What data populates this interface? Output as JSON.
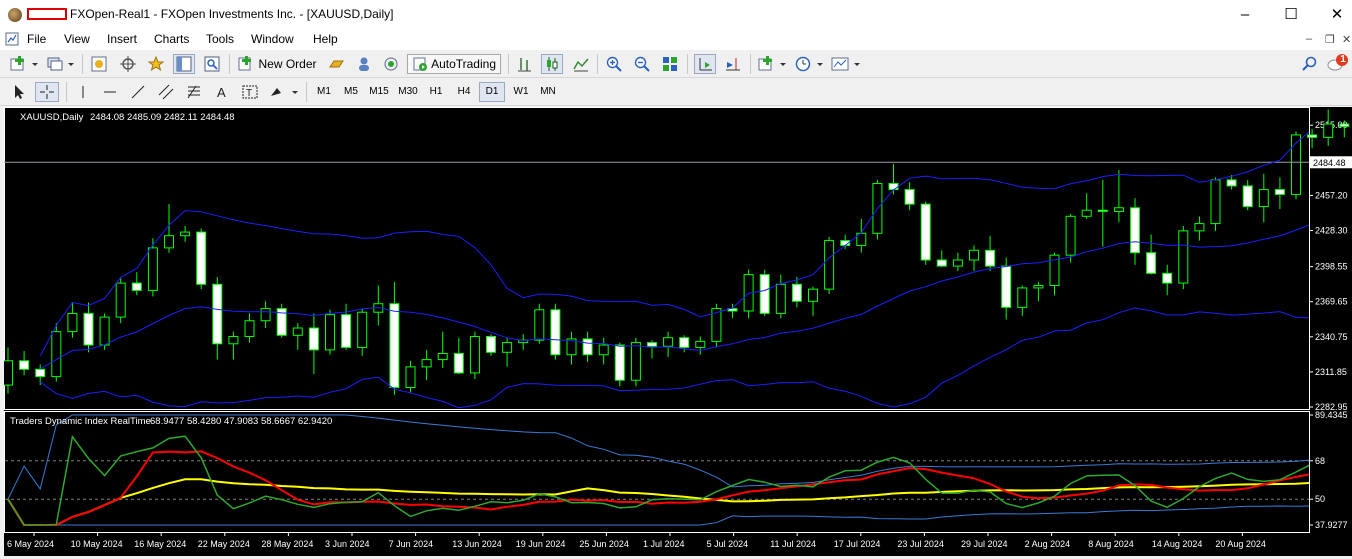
{
  "window": {
    "title": "FXOpen-Real1 - FXOpen Investments Inc. - [XAUUSD,Daily]",
    "minimize_icon": "minimize-icon",
    "maximize_icon": "maximize-icon",
    "close_icon": "close-icon"
  },
  "menu": {
    "items": [
      "File",
      "View",
      "Insert",
      "Charts",
      "Tools",
      "Window",
      "Help"
    ]
  },
  "toolbar": {
    "new_order_label": "New Order",
    "autotrading_label": "AutoTrading",
    "notifications_count": "1"
  },
  "timeframes": {
    "items": [
      "M1",
      "M5",
      "M15",
      "M30",
      "H1",
      "H4",
      "D1",
      "W1",
      "MN"
    ],
    "active": "D1"
  },
  "colors": {
    "candle_up": "#000000",
    "candle_border": "#00ff00",
    "candle_down": "#ffffff",
    "bands": "#1e1eff",
    "rsi_line": "#2ea82e",
    "signal_line": "#ff0000",
    "market_base": "#ffff00",
    "volatility_band": "#3a7bd5"
  },
  "chart_data": [
    {
      "type": "candlestick",
      "title": "XAUUSD,Daily",
      "ohlc_header": "2484.08 2485.09 2482.11 2484.48",
      "current_price_label": "2484.48",
      "current_price": 2484.48,
      "y_tick_labels": [
        "2515.00",
        "2484.48",
        "2457.20",
        "2428.30",
        "2398.55",
        "2369.65",
        "2340.75",
        "2311.85",
        "2282.95"
      ],
      "ylim": [
        2282.95,
        2530
      ],
      "x_tick_labels": [
        "6 May 2024",
        "10 May 2024",
        "16 May 2024",
        "22 May 2024",
        "28 May 2024",
        "3 Jun 2024",
        "7 Jun 2024",
        "13 Jun 2024",
        "19 Jun 2024",
        "25 Jun 2024",
        "1 Jul 2024",
        "5 Jul 2024",
        "11 Jul 2024",
        "17 Jul 2024",
        "23 Jul 2024",
        "29 Jul 2024",
        "2 Aug 2024",
        "8 Aug 2024",
        "14 Aug 2024",
        "20 Aug 2024"
      ],
      "candles": [
        [
          2301,
          2332,
          2294,
          2321
        ],
        [
          2321,
          2329,
          2309,
          2314
        ],
        [
          2314,
          2318,
          2301,
          2308
        ],
        [
          2308,
          2352,
          2304,
          2345
        ],
        [
          2345,
          2369,
          2340,
          2360
        ],
        [
          2360,
          2369,
          2328,
          2334
        ],
        [
          2334,
          2360,
          2330,
          2357
        ],
        [
          2357,
          2390,
          2352,
          2385
        ],
        [
          2385,
          2394,
          2375,
          2379
        ],
        [
          2379,
          2422,
          2374,
          2414
        ],
        [
          2414,
          2450,
          2410,
          2424
        ],
        [
          2424,
          2432,
          2419,
          2427
        ],
        [
          2427,
          2430,
          2380,
          2384
        ],
        [
          2384,
          2390,
          2322,
          2335
        ],
        [
          2335,
          2345,
          2322,
          2341
        ],
        [
          2341,
          2360,
          2336,
          2354
        ],
        [
          2354,
          2370,
          2348,
          2364
        ],
        [
          2364,
          2368,
          2340,
          2342
        ],
        [
          2342,
          2352,
          2330,
          2348
        ],
        [
          2348,
          2360,
          2310,
          2330
        ],
        [
          2330,
          2363,
          2326,
          2359
        ],
        [
          2359,
          2368,
          2330,
          2332
        ],
        [
          2332,
          2364,
          2325,
          2361
        ],
        [
          2361,
          2383,
          2350,
          2368
        ],
        [
          2368,
          2386,
          2293,
          2299
        ],
        [
          2299,
          2321,
          2295,
          2316
        ],
        [
          2316,
          2330,
          2305,
          2322
        ],
        [
          2322,
          2345,
          2315,
          2327
        ],
        [
          2327,
          2340,
          2310,
          2311
        ],
        [
          2311,
          2345,
          2306,
          2341
        ],
        [
          2341,
          2343,
          2325,
          2328
        ],
        [
          2328,
          2340,
          2316,
          2336
        ],
        [
          2336,
          2343,
          2330,
          2338
        ],
        [
          2338,
          2368,
          2335,
          2363
        ],
        [
          2363,
          2368,
          2322,
          2326
        ],
        [
          2326,
          2345,
          2318,
          2339
        ],
        [
          2339,
          2345,
          2320,
          2326
        ],
        [
          2326,
          2340,
          2318,
          2334
        ],
        [
          2334,
          2336,
          2300,
          2305
        ],
        [
          2305,
          2340,
          2300,
          2336
        ],
        [
          2336,
          2338,
          2323,
          2333
        ],
        [
          2333,
          2345,
          2324,
          2340
        ],
        [
          2340,
          2342,
          2328,
          2332
        ],
        [
          2332,
          2341,
          2326,
          2337
        ],
        [
          2337,
          2368,
          2332,
          2364
        ],
        [
          2364,
          2368,
          2356,
          2362
        ],
        [
          2362,
          2396,
          2356,
          2392
        ],
        [
          2392,
          2396,
          2358,
          2360
        ],
        [
          2360,
          2392,
          2356,
          2384
        ],
        [
          2384,
          2390,
          2365,
          2370
        ],
        [
          2370,
          2382,
          2358,
          2380
        ],
        [
          2380,
          2423,
          2376,
          2420
        ],
        [
          2420,
          2425,
          2413,
          2416
        ],
        [
          2416,
          2438,
          2410,
          2426
        ],
        [
          2426,
          2470,
          2421,
          2467
        ],
        [
          2467,
          2483,
          2458,
          2462
        ],
        [
          2462,
          2468,
          2445,
          2450
        ],
        [
          2450,
          2452,
          2400,
          2404
        ],
        [
          2404,
          2412,
          2398,
          2399
        ],
        [
          2399,
          2410,
          2395,
          2404
        ],
        [
          2404,
          2416,
          2395,
          2412
        ],
        [
          2412,
          2424,
          2395,
          2399
        ],
        [
          2399,
          2406,
          2355,
          2365
        ],
        [
          2365,
          2383,
          2358,
          2381
        ],
        [
          2381,
          2386,
          2370,
          2383
        ],
        [
          2383,
          2410,
          2375,
          2408
        ],
        [
          2408,
          2442,
          2402,
          2440
        ],
        [
          2440,
          2459,
          2438,
          2445
        ],
        [
          2445,
          2470,
          2415,
          2444
        ],
        [
          2444,
          2478,
          2435,
          2447
        ],
        [
          2447,
          2455,
          2400,
          2410
        ],
        [
          2410,
          2425,
          2392,
          2393
        ],
        [
          2393,
          2400,
          2375,
          2385
        ],
        [
          2385,
          2432,
          2380,
          2428
        ],
        [
          2428,
          2440,
          2420,
          2434
        ],
        [
          2434,
          2472,
          2428,
          2470
        ],
        [
          2470,
          2474,
          2462,
          2465
        ],
        [
          2465,
          2470,
          2445,
          2448
        ],
        [
          2448,
          2475,
          2435,
          2462
        ],
        [
          2462,
          2472,
          2446,
          2458
        ],
        [
          2458,
          2510,
          2454,
          2507
        ],
        [
          2507,
          2512,
          2496,
          2505
        ],
        [
          2505,
          2528,
          2498,
          2516
        ],
        [
          2516,
          2519,
          2505,
          2514
        ],
        [
          2514,
          2518,
          2470,
          2488
        ],
        [
          2484.08,
          2485.09,
          2482.11,
          2484.48
        ]
      ]
    },
    {
      "type": "line",
      "title": "Traders Dynamic Index RealTime",
      "values_header": "68.9477 58.4280 47.9083 58.6667 62.9420",
      "y_tick_labels": [
        "89.4345",
        "68",
        "50",
        "37.9277"
      ],
      "ylim": [
        37.9277,
        89.4345
      ],
      "levels": [
        68,
        50
      ],
      "series": []
    }
  ]
}
